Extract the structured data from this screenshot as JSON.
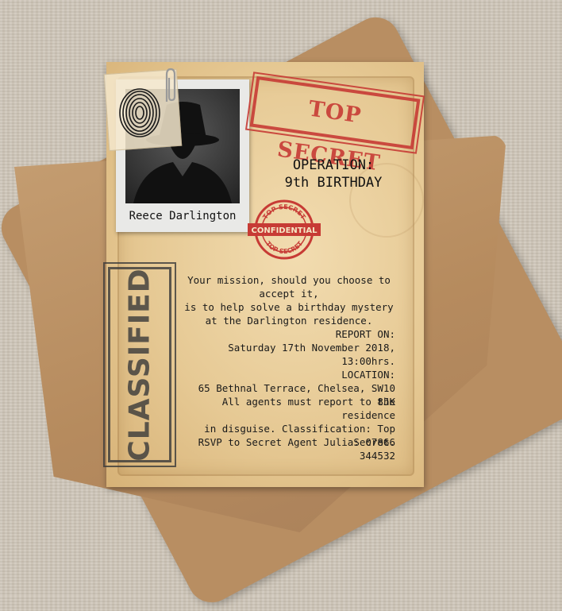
{
  "photo": {
    "name": "Reece Darlington"
  },
  "stamps": {
    "top_secret": "TOP SECRET",
    "confidential": "CONFIDENTIAL",
    "confidential_ring_top": "TOP SECRET",
    "confidential_ring_bottom": "TOP SECRET",
    "classified": "CLASSIFIED"
  },
  "operation": {
    "line1": "OPERATION:",
    "line2": "9th BIRTHDAY"
  },
  "mission": [
    "Your mission, should you choose to accept it,",
    "is to help solve a birthday mystery",
    "at the Darlington residence."
  ],
  "report": {
    "label": "REPORT ON:",
    "value": "Saturday 17th November 2018, 13:00hrs.",
    "location_label": "LOCATION:",
    "location_value": "65 Bethnal Terrace, Chelsea, SW10 8JK"
  },
  "agents": [
    "All agents must report to the residence",
    "in disguise. Classification: Top Secret."
  ],
  "rsvp": "RSVP to Secret Agent Julia: 07866 344532",
  "colors": {
    "stamp_red": "#c73b35",
    "paper": "#e6c994",
    "kraft": "#b88e62"
  }
}
